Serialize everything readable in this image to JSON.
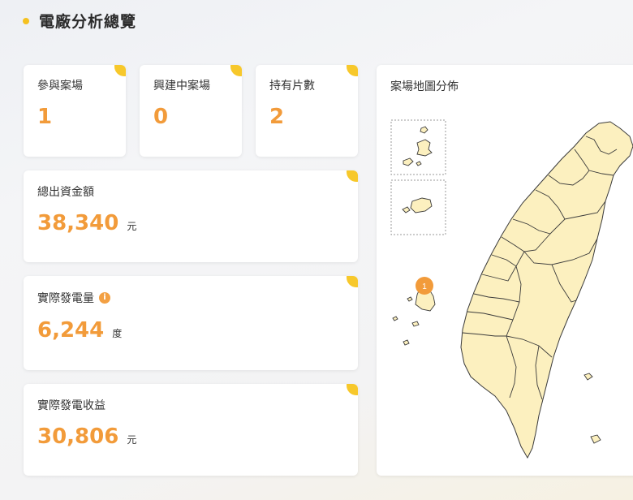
{
  "header": {
    "title": "電廠分析總覽"
  },
  "stats": {
    "participating": {
      "label": "參與案場",
      "value": "1"
    },
    "building": {
      "label": "興建中案場",
      "value": "0"
    },
    "panels": {
      "label": "持有片數",
      "value": "2"
    },
    "investment": {
      "label": "總出資金額",
      "value": "38,340",
      "unit": "元"
    },
    "generation": {
      "label": "實際發電量",
      "value": "6,244",
      "unit": "度",
      "info_icon": "i"
    },
    "revenue": {
      "label": "實際發電收益",
      "value": "30,806",
      "unit": "元"
    }
  },
  "map": {
    "title": "案場地圖分佈",
    "marker_count": "1"
  },
  "colors": {
    "accent": "#f29b3a",
    "corner": "#f7c82b",
    "map_fill": "#fcf0bf",
    "map_stroke": "#3a3a3a"
  }
}
